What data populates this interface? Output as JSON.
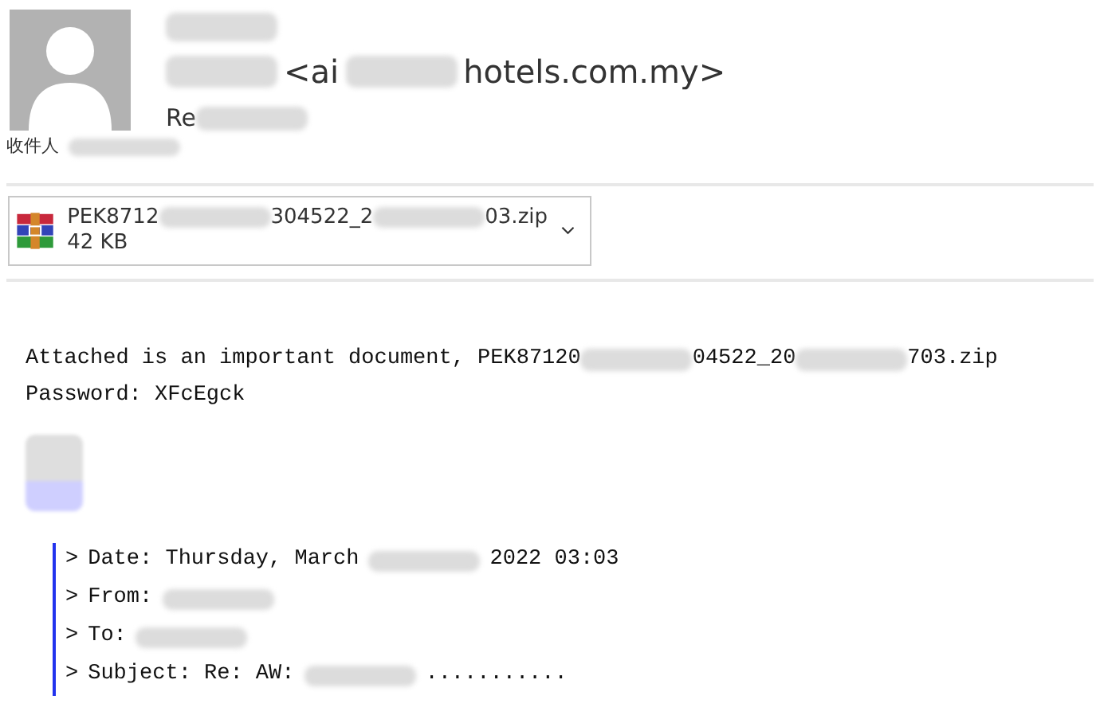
{
  "header": {
    "top_line": [
      {
        "kind": "redacted"
      }
    ],
    "sender": [
      {
        "kind": "redacted"
      },
      {
        "kind": "text",
        "text": "<ai"
      },
      {
        "kind": "redacted"
      },
      {
        "kind": "text",
        "text": "hotels.com.my>"
      }
    ],
    "subject": [
      {
        "kind": "text",
        "text": "Re"
      },
      {
        "kind": "redacted"
      }
    ],
    "recipients": [
      {
        "kind": "text",
        "text": "收件人"
      },
      {
        "kind": "redacted"
      }
    ]
  },
  "attachment": {
    "name": [
      {
        "kind": "text",
        "text": "PEK8712"
      },
      {
        "kind": "redacted"
      },
      {
        "kind": "text",
        "text": "304522_2"
      },
      {
        "kind": "redacted"
      },
      {
        "kind": "text",
        "text": "03.zip"
      }
    ],
    "size": "42 KB"
  },
  "body": {
    "lines": [
      [
        {
          "kind": "text",
          "text": "Attached is an important document, PEK87120"
        },
        {
          "kind": "redacted"
        },
        {
          "kind": "text",
          "text": "04522_20"
        },
        {
          "kind": "redacted"
        },
        {
          "kind": "text",
          "text": "703.zip"
        }
      ],
      [
        {
          "kind": "text",
          "text": "Password: XFcEgck"
        }
      ]
    ],
    "signature": {
      "kind": "redacted"
    },
    "quote": [
      [
        {
          "kind": "text",
          "text": ">"
        },
        {
          "kind": "text",
          "text": "Date: Thursday, March"
        },
        {
          "kind": "redacted"
        },
        {
          "kind": "text",
          "text": "2022 03:03"
        }
      ],
      [
        {
          "kind": "text",
          "text": ">"
        },
        {
          "kind": "text",
          "text": "From:"
        },
        {
          "kind": "redacted"
        }
      ],
      [
        {
          "kind": "text",
          "text": ">"
        },
        {
          "kind": "text",
          "text": "To:"
        },
        {
          "kind": "redacted"
        }
      ],
      [
        {
          "kind": "text",
          "text": ">"
        },
        {
          "kind": "text",
          "text": "Subject: Re: AW:"
        },
        {
          "kind": "redacted"
        },
        {
          "kind": "text",
          "text": "..........."
        }
      ]
    ]
  }
}
